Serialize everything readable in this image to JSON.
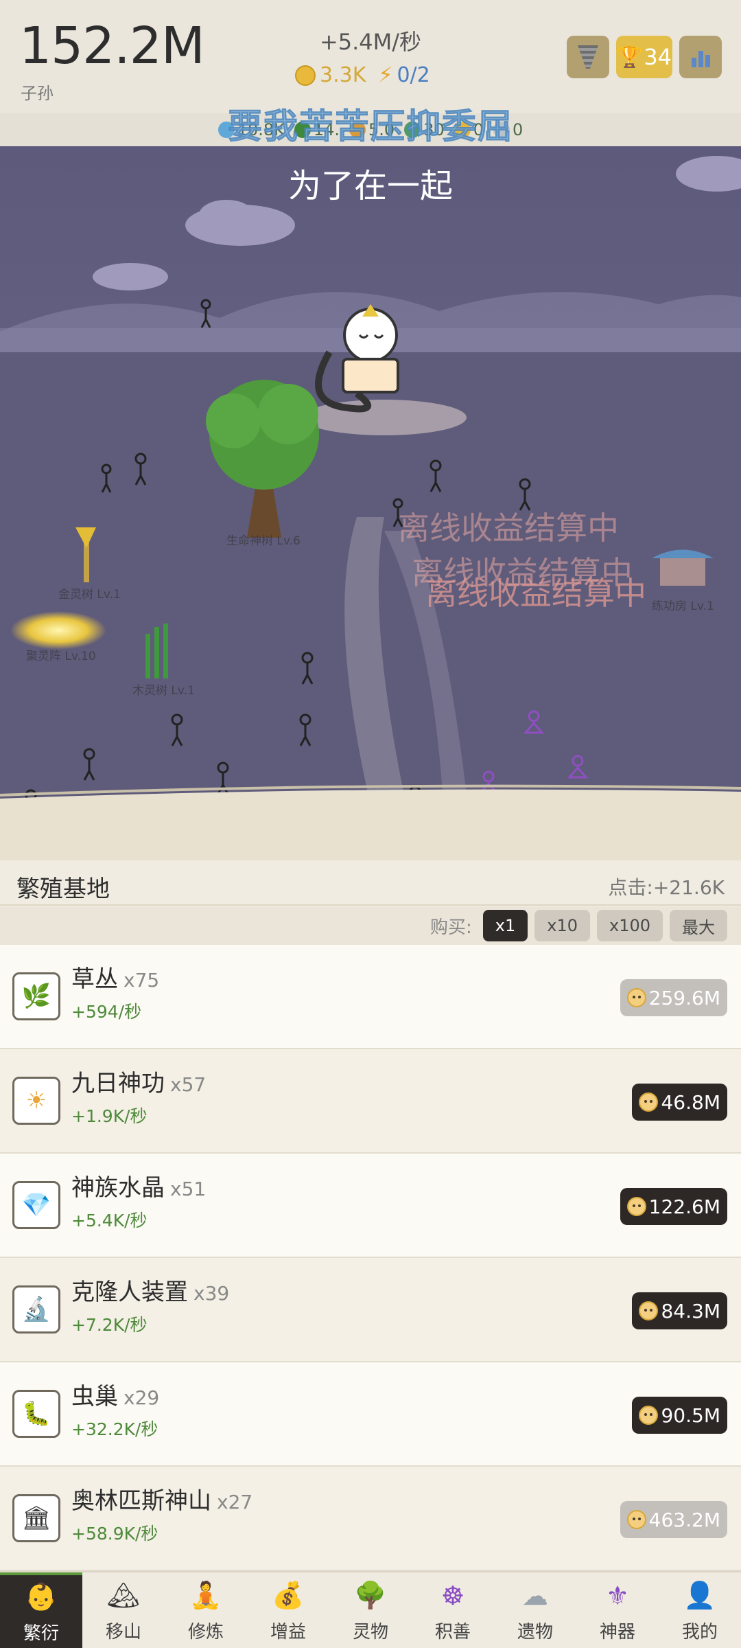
{
  "header": {
    "population_value": "152.2M",
    "population_label": "子孙",
    "rate": "+5.4M/秒",
    "coins": "3.3K",
    "energy": "0/2",
    "trophy_count": "34"
  },
  "resources": [
    "10.8K",
    "14.",
    "5.0",
    "30",
    "0",
    "0"
  ],
  "overlay_banner": "要我苦苦压抑委屈",
  "scene": {
    "caption": "为了在一起",
    "offline_text": "离线收益结算中",
    "buildings": {
      "life_tree": "生命神树 Lv.6",
      "gold_tree": "金灵树 Lv.1",
      "array": "聚灵阵 Lv.10",
      "wood_tree": "木灵树 Lv.1",
      "practice_hall": "练功房 Lv.1"
    }
  },
  "section": {
    "title": "繁殖基地",
    "click_rate": "点击:+21.6K"
  },
  "buy": {
    "label": "购买:",
    "options": [
      "x1",
      "x10",
      "x100",
      "最大"
    ]
  },
  "items": [
    {
      "name": "草丛",
      "count": "x75",
      "rate": "+594/秒",
      "cost": "259.6M",
      "icon": "herb-icon",
      "affordable": false
    },
    {
      "name": "九日神功",
      "count": "x57",
      "rate": "+1.9K/秒",
      "cost": "46.8M",
      "icon": "sun-icon",
      "affordable": true
    },
    {
      "name": "神族水晶",
      "count": "x51",
      "rate": "+5.4K/秒",
      "cost": "122.6M",
      "icon": "gem-icon",
      "affordable": true
    },
    {
      "name": "克隆人装置",
      "count": "x39",
      "rate": "+7.2K/秒",
      "cost": "84.3M",
      "icon": "microscope-icon",
      "affordable": true
    },
    {
      "name": "虫巢",
      "count": "x29",
      "rate": "+32.2K/秒",
      "cost": "90.5M",
      "icon": "worm-icon",
      "affordable": true
    },
    {
      "name": "奥林匹斯神山",
      "count": "x27",
      "rate": "+58.9K/秒",
      "cost": "463.2M",
      "icon": "temple-icon",
      "affordable": false
    }
  ],
  "nav": [
    {
      "label": "繁衍",
      "icon": "baby-icon"
    },
    {
      "label": "移山",
      "icon": "mountain-icon"
    },
    {
      "label": "修炼",
      "icon": "monk-icon"
    },
    {
      "label": "增益",
      "icon": "money-bag-icon"
    },
    {
      "label": "灵物",
      "icon": "tree-icon"
    },
    {
      "label": "积善",
      "icon": "wheel-icon"
    },
    {
      "label": "遗物",
      "icon": "cloud-icon"
    },
    {
      "label": "神器",
      "icon": "fleur-icon"
    },
    {
      "label": "我的",
      "icon": "user-icon"
    }
  ]
}
